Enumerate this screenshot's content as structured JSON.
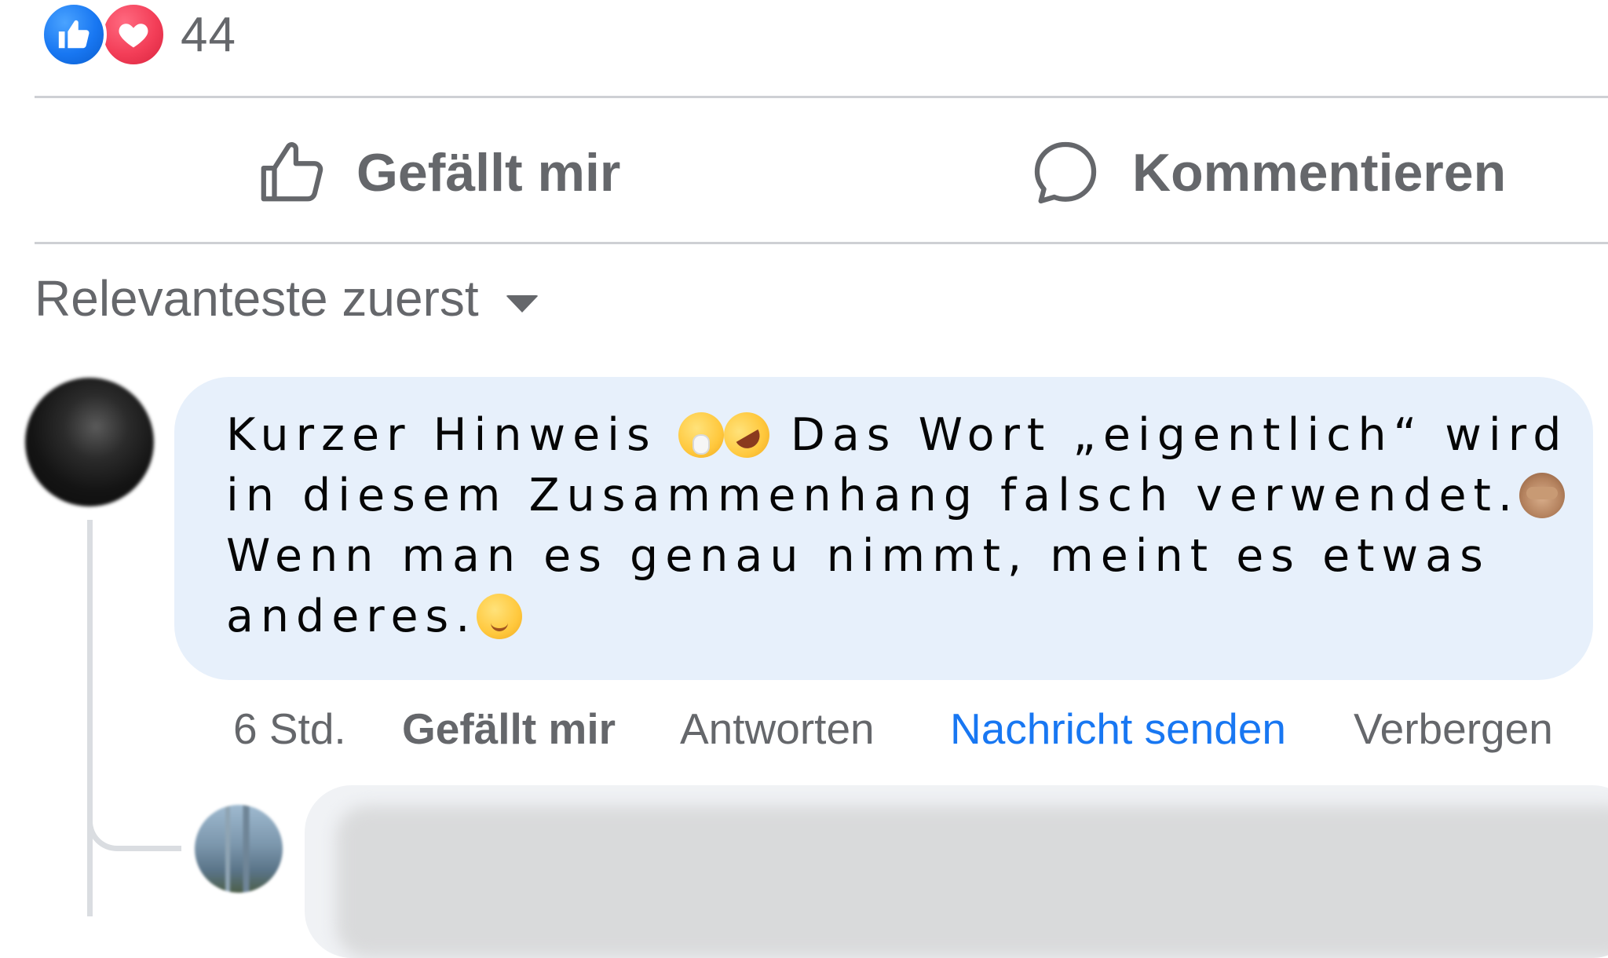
{
  "reactions": {
    "count": "44",
    "types": [
      "like-icon",
      "love-icon"
    ],
    "like_color": "#1877f2",
    "love_color": "#f33e58"
  },
  "actions": {
    "like_label": "Gefällt mir",
    "like_icon": "thumbs-up-outline-icon",
    "comment_label": "Kommentieren",
    "comment_icon": "speech-bubble-outline-icon"
  },
  "sort": {
    "label": "Relevanteste zuerst",
    "icon": "caret-down-icon"
  },
  "comment": {
    "text_lines": [
      {
        "before": "Kurzer Hinweis ",
        "emojis": [
          "shushing-face-emoji",
          "rofl-emoji"
        ],
        "after": " Das Wort „eigentlich“ wird"
      },
      {
        "before": "in diesem Zusammenhang falsch verwendet.",
        "emojis": [
          "see-no-evil-monkey-emoji"
        ],
        "after": ""
      },
      {
        "before": "Wenn man es genau nimmt, meint es etwas",
        "emojis": [],
        "after": ""
      },
      {
        "before": "anderes.",
        "emojis": [
          "winking-face-emoji"
        ],
        "after": ""
      }
    ],
    "bubble_color": "#e7f0fb",
    "meta": {
      "time": "6 Std.",
      "like": "Gefällt mir",
      "reply": "Antworten",
      "message": "Nachricht senden",
      "hide": "Verbergen"
    },
    "accent_color": "#1877f2"
  }
}
